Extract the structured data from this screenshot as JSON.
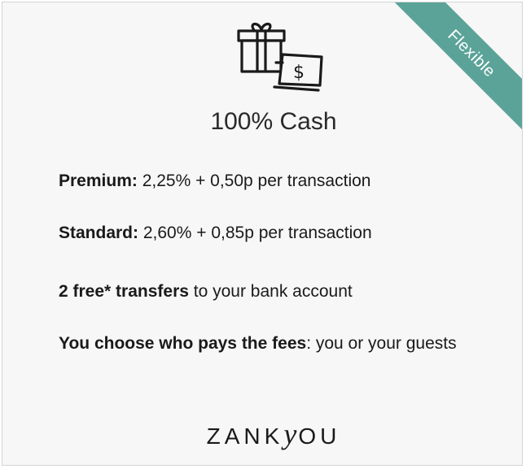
{
  "badge": {
    "label": "Flexible",
    "color": "#5ba398"
  },
  "header": {
    "icon": "gift-cash-icon",
    "title": "100% Cash"
  },
  "pricing": [
    {
      "label": "Premium:",
      "text": " 2,25% + 0,50p per transaction"
    },
    {
      "label": "Standard:",
      "text": " 2,60% + 0,85p per transaction"
    }
  ],
  "transfers": {
    "bold": "2 free* transfers",
    "text": " to your bank account"
  },
  "fees": {
    "bold": "You choose who pays the fees",
    "text": ": you or your guests"
  },
  "brand": {
    "pre": "ZANK",
    "script": "y",
    "post": "OU"
  }
}
